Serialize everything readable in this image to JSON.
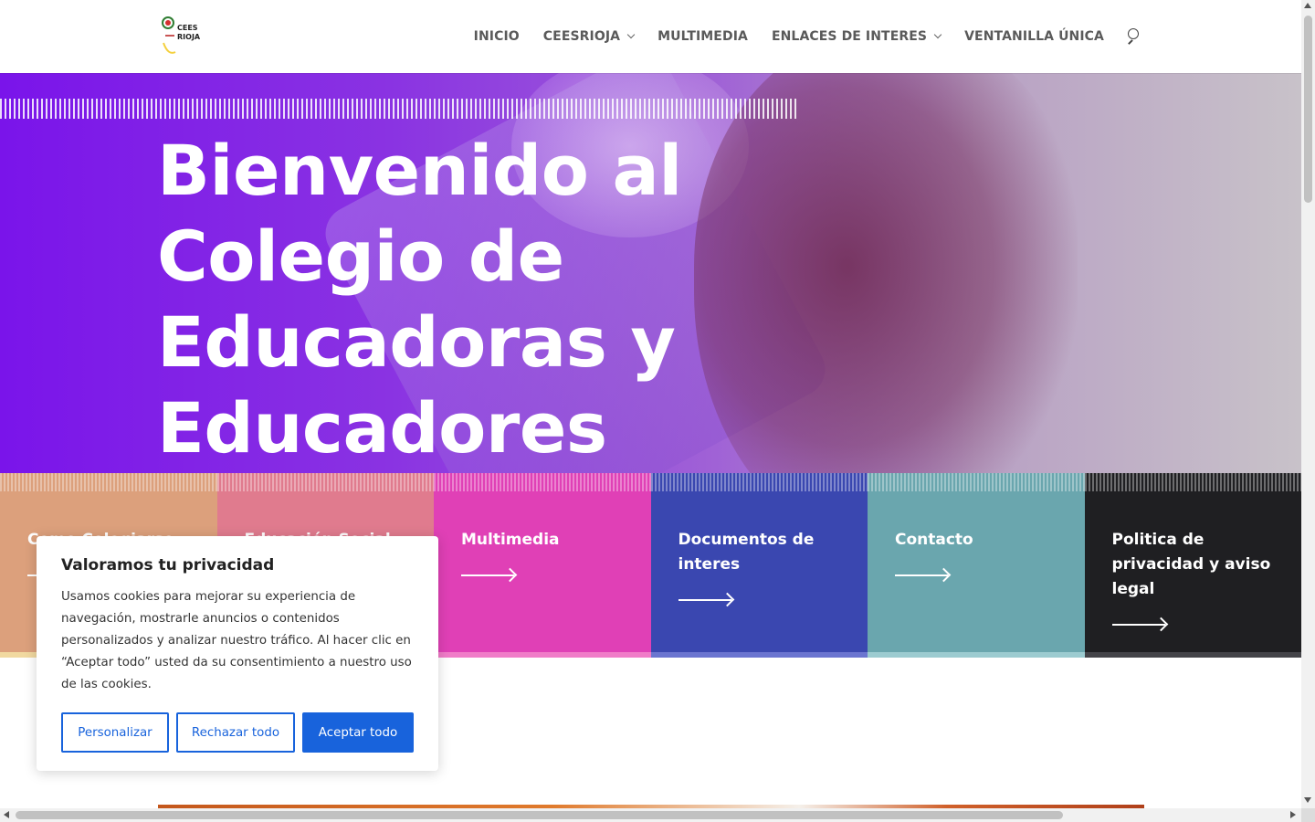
{
  "header": {
    "logo_alt": "CEES RIOJA",
    "nav": [
      {
        "label": "INICIO",
        "has_submenu": false
      },
      {
        "label": "CEESRIOJA",
        "has_submenu": true
      },
      {
        "label": "MULTIMEDIA",
        "has_submenu": false
      },
      {
        "label": "ENLACES DE INTERES",
        "has_submenu": true
      },
      {
        "label": "VENTANILLA ÚNICA",
        "has_submenu": false
      }
    ],
    "search_icon": "search-icon"
  },
  "hero": {
    "title": "Bienvenido al Colegio de Educadoras y Educadores Sociales de La Rioja"
  },
  "cards": [
    {
      "title": "Como Colegiarse",
      "color": "#dca07c"
    },
    {
      "title": "Educación Social",
      "color": "#e07b8e"
    },
    {
      "title": "Multimedia",
      "color": "#e040b6"
    },
    {
      "title": "Documentos de interes",
      "color": "#3a47b0"
    },
    {
      "title": "Contacto",
      "color": "#6aa6ae"
    },
    {
      "title": "Politica de privacidad y aviso legal",
      "color": "#1f1f22"
    }
  ],
  "cookie_banner": {
    "title": "Valoramos tu privacidad",
    "text": "Usamos cookies para mejorar su experiencia de navegación, mostrarle anuncios o contenidos personalizados y analizar nuestro tráfico. Al hacer clic en “Aceptar todo” usted da su consentimiento a nuestro uso de las cookies.",
    "buttons": {
      "customize": "Personalizar",
      "reject": "Rechazar todo",
      "accept": "Aceptar todo"
    },
    "accent_color": "#1863dc"
  }
}
